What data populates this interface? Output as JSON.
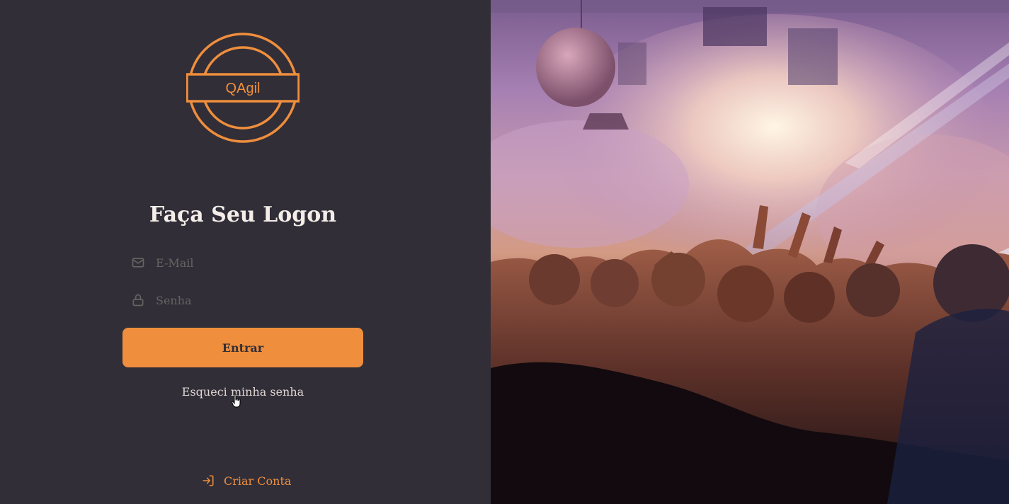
{
  "brand": {
    "logo_text": "QAgil",
    "accent_color": "#ef8e3c",
    "background_color": "#312e38"
  },
  "form": {
    "title": "Faça Seu Logon",
    "email": {
      "placeholder": "E-Mail",
      "value": "",
      "icon": "mail-icon"
    },
    "password": {
      "placeholder": "Senha",
      "value": "",
      "icon": "lock-icon"
    },
    "submit_label": "Entrar",
    "forgot_label": "Esqueci minha senha"
  },
  "footer": {
    "create_account_label": "Criar Conta",
    "create_account_icon": "log-in-icon"
  },
  "hero": {
    "image": "concert-crowd-photo"
  }
}
